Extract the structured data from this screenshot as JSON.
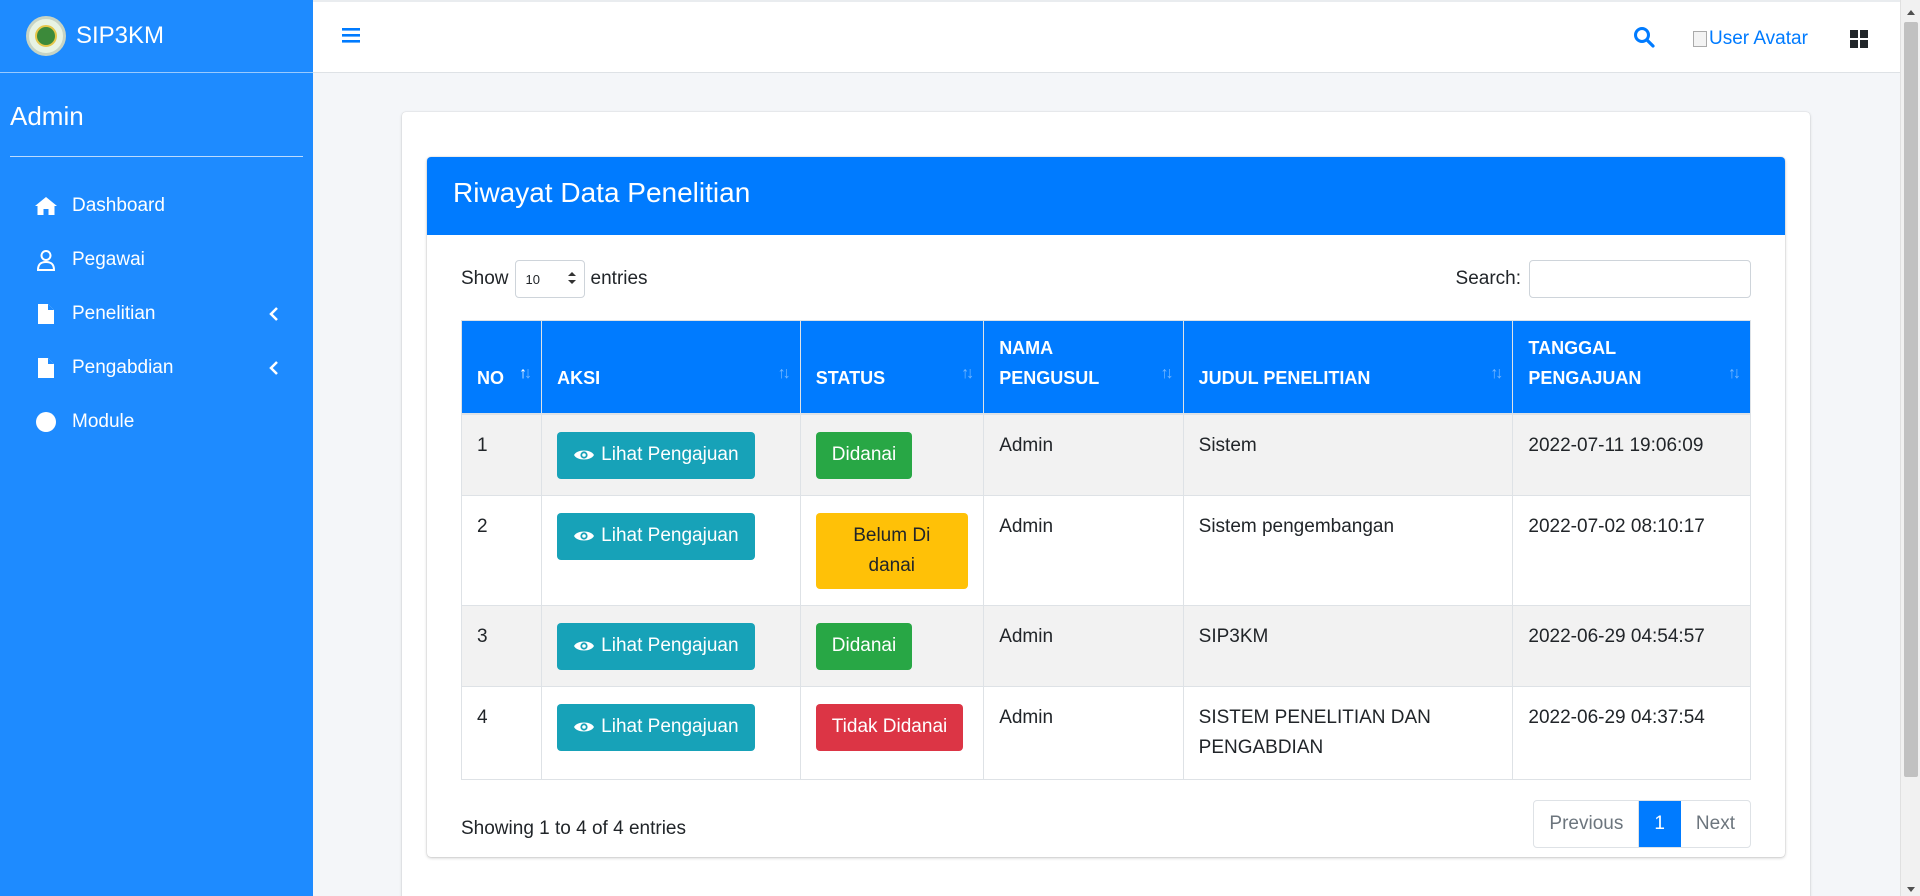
{
  "app": {
    "title": "SIP3KM"
  },
  "user": {
    "name": "Admin"
  },
  "sidebar": {
    "items": [
      {
        "label": "Dashboard",
        "icon": "home-icon"
      },
      {
        "label": "Pegawai",
        "icon": "user-icon"
      },
      {
        "label": "Penelitian",
        "icon": "file-icon",
        "has_children": true
      },
      {
        "label": "Pengabdian",
        "icon": "file-icon",
        "has_children": true
      },
      {
        "label": "Module",
        "icon": "circle-icon"
      }
    ]
  },
  "topbar": {
    "avatar_alt": "User Avatar"
  },
  "card": {
    "title": "Riwayat Data Penelitian"
  },
  "datatable": {
    "show_label": "Show",
    "length_value": "10",
    "entries_label": "entries",
    "search_label": "Search:",
    "search_value": "",
    "columns": [
      "NO",
      "AKSI",
      "STATUS",
      "NAMA\nPENGUSUL",
      "JUDUL PENELITIAN",
      "TANGGAL\nPENGAJUAN"
    ],
    "rows": [
      {
        "no": "1",
        "action": "Lihat Pengajuan",
        "status": "Didanai",
        "status_color": "#28a745",
        "pengusul": "Admin",
        "judul": "Sistem",
        "tanggal": "2022-07-11 19:06:09"
      },
      {
        "no": "2",
        "action": "Lihat Pengajuan",
        "status": "Belum Di danai",
        "status_color": "#ffc107",
        "pengusul": "Admin",
        "judul": "Sistem pengembangan",
        "tanggal": "2022-07-02 08:10:17"
      },
      {
        "no": "3",
        "action": "Lihat Pengajuan",
        "status": "Didanai",
        "status_color": "#28a745",
        "pengusul": "Admin",
        "judul": "SIP3KM",
        "tanggal": "2022-06-29 04:54:57"
      },
      {
        "no": "4",
        "action": "Lihat Pengajuan",
        "status": "Tidak Didanai",
        "status_color": "#dc3545",
        "pengusul": "Admin",
        "judul": "SISTEM PENELITIAN DAN PENGABDIAN",
        "tanggal": "2022-06-29 04:37:54"
      }
    ],
    "info": "Showing 1 to 4 of 4 entries",
    "pagination": {
      "previous": "Previous",
      "current": "1",
      "next": "Next"
    }
  },
  "colors": {
    "sidebar": "#1e8bff",
    "primary": "#007bff",
    "info_button": "#17a2b8"
  }
}
